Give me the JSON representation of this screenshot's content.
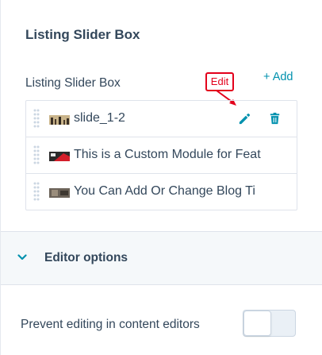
{
  "section": {
    "title": "Listing Slider Box"
  },
  "field": {
    "label": "Listing Slider Box",
    "add_label": "+ Add"
  },
  "callout": {
    "text": "Edit"
  },
  "items": [
    {
      "label": "slide_1-2",
      "thumb_icon": "thumbnail-icon",
      "selected": true
    },
    {
      "label": "This is a Custom Module for Feat",
      "thumb_icon": "thumbnail-icon"
    },
    {
      "label": "You Can Add Or Change Blog Ti",
      "thumb_icon": "thumbnail-icon"
    }
  ],
  "editor_options": {
    "label": "Editor options",
    "expanded": false
  },
  "prevent_editing": {
    "label": "Prevent editing in content editors",
    "enabled": false
  },
  "colors": {
    "accent": "#0091ae",
    "text": "#33475b",
    "callout": "#e3001b",
    "border": "#dfe3eb"
  }
}
